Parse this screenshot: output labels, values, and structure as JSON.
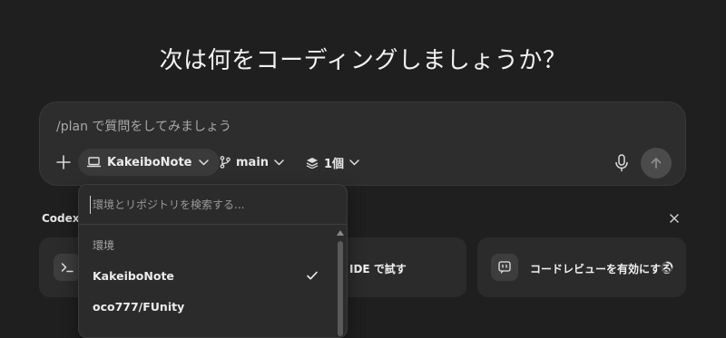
{
  "headline": "次は何をコーディングしましょうか？",
  "composer": {
    "placeholder": "/plan で質問をしてみましょう",
    "environment": "KakeiboNote",
    "branch": "main",
    "versions": "1個"
  },
  "suggestions": {
    "section_label": "Codex",
    "cards": [
      {
        "label": ""
      },
      {
        "label": "IDE で試す"
      },
      {
        "label": "コードレビューを有効にする"
      }
    ]
  },
  "dropdown": {
    "search_placeholder": "環境とリポジトリを検索する...",
    "section_label": "環境",
    "items": [
      {
        "label": "KakeiboNote",
        "selected": true
      },
      {
        "label": "oco777/FUnity",
        "selected": false
      }
    ]
  }
}
